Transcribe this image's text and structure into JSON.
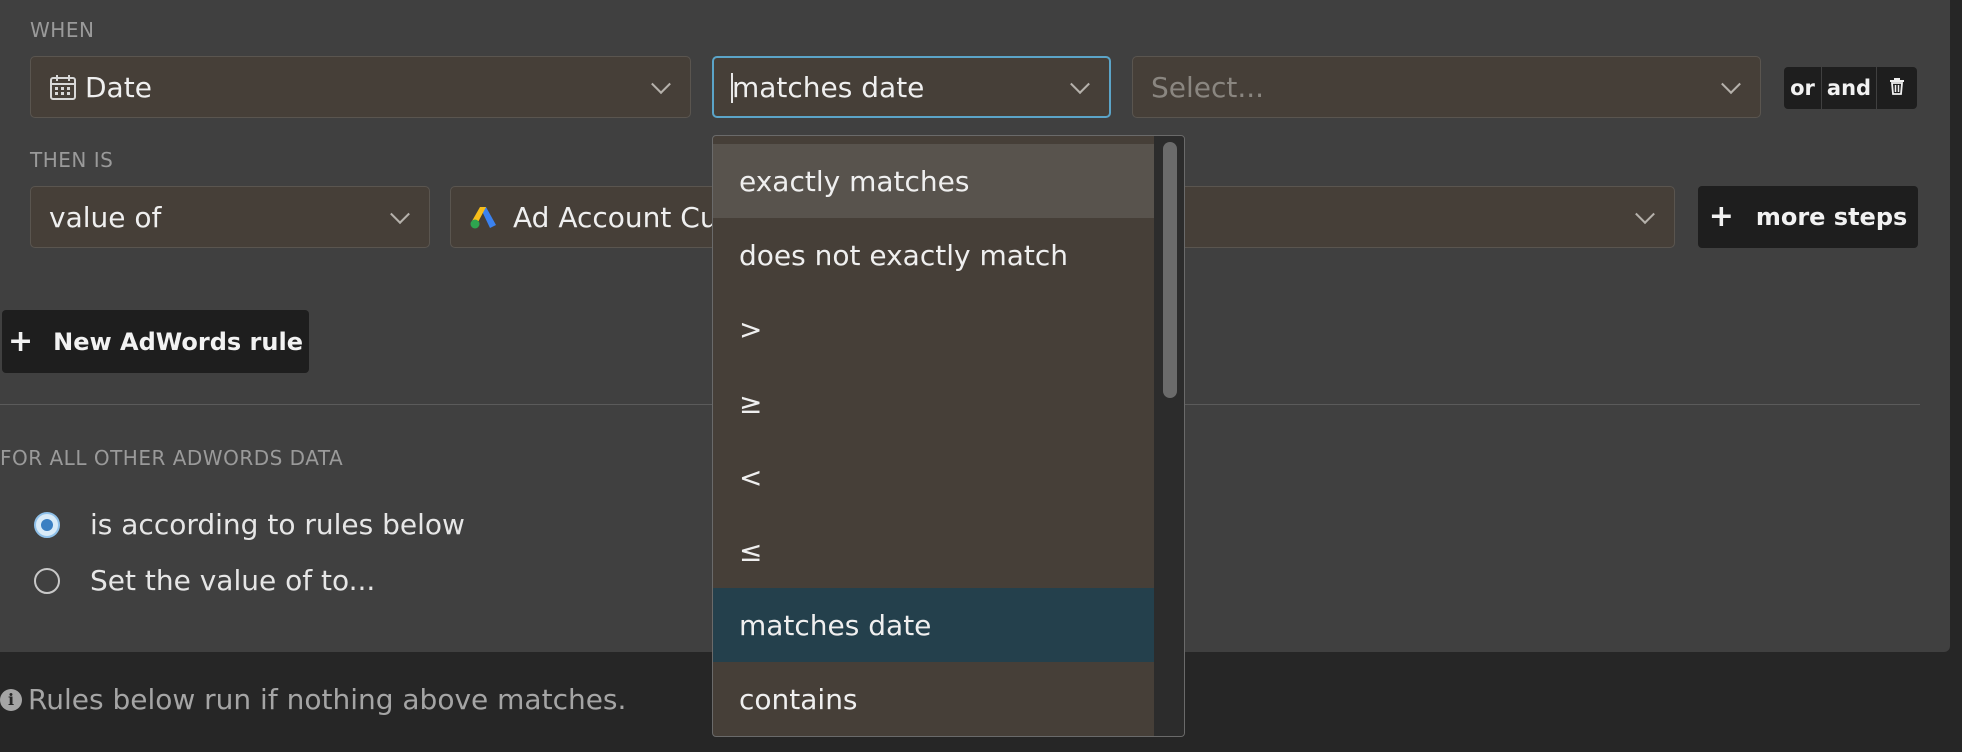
{
  "when": {
    "label": "WHEN",
    "field": {
      "value": "Date",
      "icon": "calendar-icon"
    },
    "operator": {
      "value": "matches date"
    },
    "value_select": {
      "placeholder": "Select..."
    },
    "or_label": "or",
    "and_label": "and",
    "delete_icon": "trash-icon"
  },
  "then": {
    "label": "THEN IS",
    "mode": {
      "value": "value of"
    },
    "source": {
      "value": "Ad Account Cust",
      "icon": "google-ads-icon"
    },
    "more_steps_label": "more steps"
  },
  "new_rule_label": "New AdWords rule",
  "other": {
    "label": "FOR ALL OTHER ADWORDS DATA",
    "options": [
      {
        "label": "is according to rules below",
        "checked": true
      },
      {
        "label": "Set the value of to...",
        "checked": false
      }
    ]
  },
  "info_text": "Rules below run if nothing above matches.",
  "operator_dropdown": {
    "items": [
      {
        "label": "exactly matches",
        "state": "hover"
      },
      {
        "label": "does not exactly match",
        "state": ""
      },
      {
        "label": ">",
        "state": ""
      },
      {
        "label": "≥",
        "state": ""
      },
      {
        "label": "<",
        "state": ""
      },
      {
        "label": "≤",
        "state": ""
      },
      {
        "label": "matches date",
        "state": "selected"
      },
      {
        "label": "contains",
        "state": ""
      }
    ]
  },
  "colors": {
    "panel": "#404040",
    "select_bg": "#463f38",
    "focus": "#5ba4c8",
    "selected_item": "#24404c"
  }
}
